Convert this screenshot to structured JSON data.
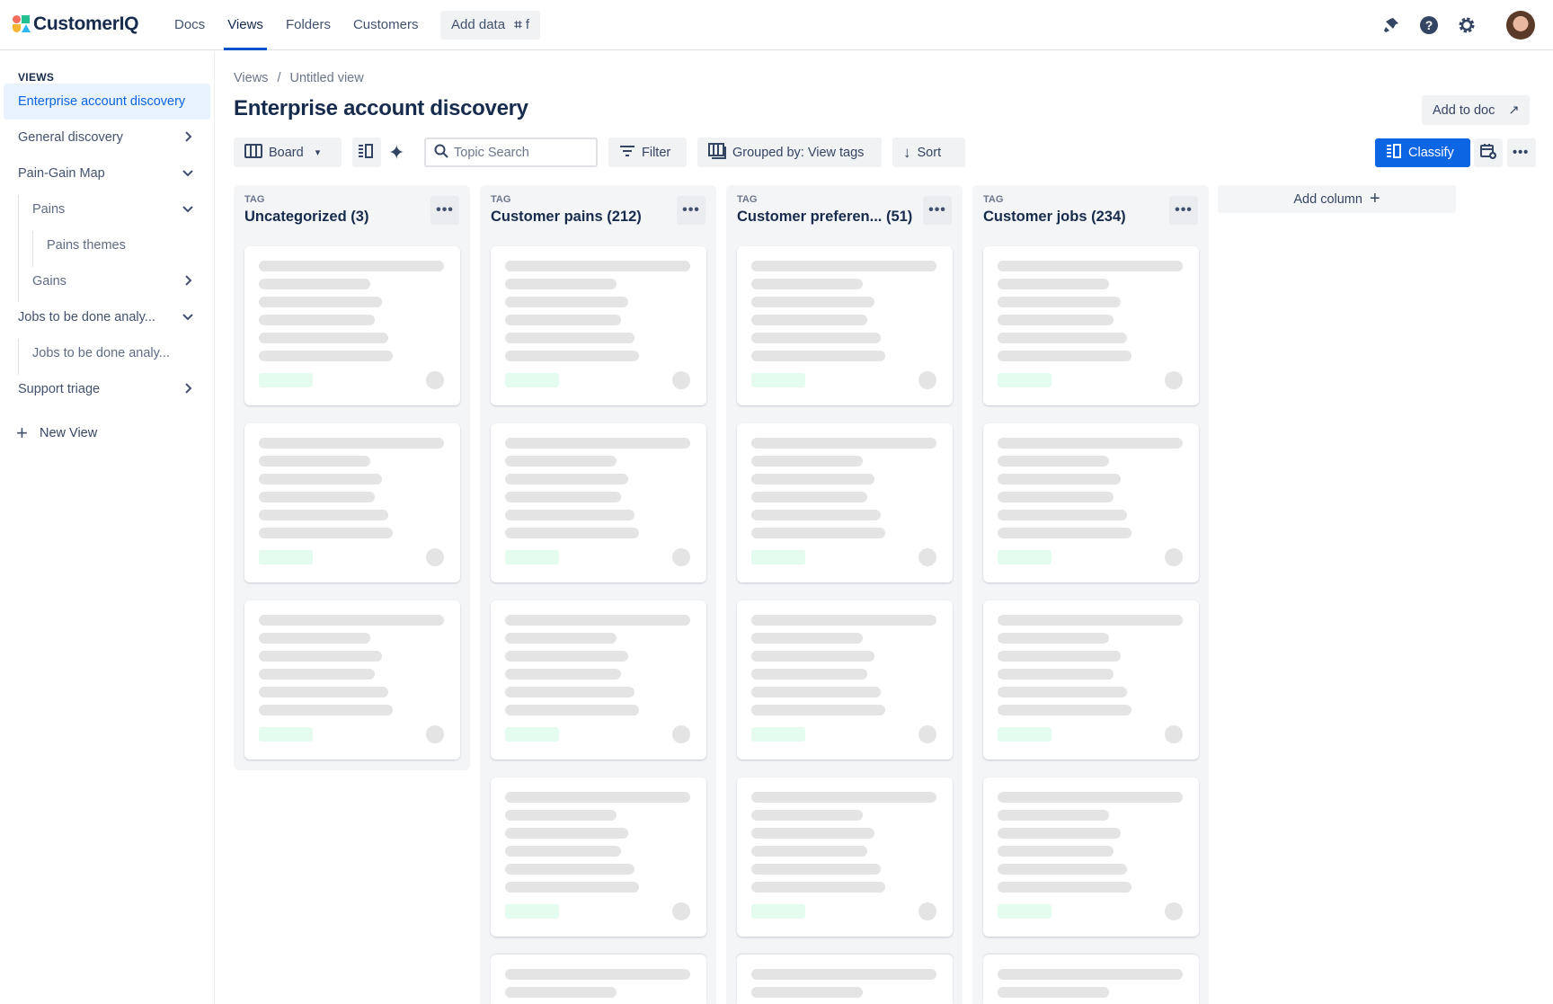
{
  "app": {
    "name": "CustomerIQ"
  },
  "nav": {
    "items": [
      "Docs",
      "Views",
      "Folders",
      "Customers"
    ],
    "active": "Views",
    "add_data": "Add data",
    "add_data_shortcut": "f"
  },
  "sidebar": {
    "heading": "VIEWS",
    "items": [
      {
        "label": "Enterprise account discovery",
        "level": 0,
        "chevron": "",
        "active": true
      },
      {
        "label": "General discovery",
        "level": 0,
        "chevron": "right"
      },
      {
        "label": "Pain-Gain Map",
        "level": 0,
        "chevron": "down"
      },
      {
        "label": "Pains",
        "level": 1,
        "chevron": "down"
      },
      {
        "label": "Pains themes",
        "level": 2,
        "chevron": ""
      },
      {
        "label": "Gains",
        "level": 1,
        "chevron": "right"
      },
      {
        "label": "Jobs to be done analy...",
        "level": 0,
        "chevron": "down"
      },
      {
        "label": "Jobs to be done analy...",
        "level": 1,
        "chevron": ""
      },
      {
        "label": "Support triage",
        "level": 0,
        "chevron": "right"
      }
    ],
    "new_view": "New View"
  },
  "breadcrumb": {
    "root": "Views",
    "sep": "/",
    "current": "Untitled view"
  },
  "page": {
    "title": "Enterprise account discovery",
    "add_to_doc": "Add to doc"
  },
  "toolbar": {
    "board": "Board",
    "search_placeholder": "Topic Search",
    "filter": "Filter",
    "grouped": "Grouped by: View tags",
    "sort": "Sort",
    "classify": "Classify"
  },
  "board": {
    "columns": [
      {
        "tag": "TAG",
        "title": "Uncategorized (3)",
        "loading_cards": 3
      },
      {
        "tag": "TAG",
        "title": "Customer pains (212)",
        "loading_cards": 5
      },
      {
        "tag": "TAG",
        "title": "Customer preferen... (51)",
        "loading_cards": 5
      },
      {
        "tag": "TAG",
        "title": "Customer jobs (234)",
        "loading_cards": 5
      }
    ],
    "add_column": "Add column"
  },
  "colors": {
    "accent": "#0c66e4",
    "active_bg": "#e9f2ff"
  }
}
